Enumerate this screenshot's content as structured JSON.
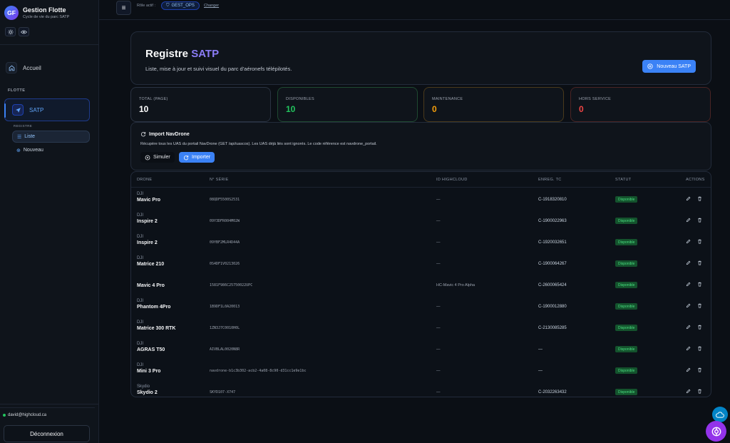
{
  "app": {
    "logo_initials": "GF",
    "title": "Gestion Flotte",
    "subtitle": "Cycle de vie du parc SATP"
  },
  "sidebar": {
    "home_label": "Accueil",
    "section_label": "FLOTTE",
    "satp_label": "SATP",
    "sub_section_label": "REGISTRE",
    "sub_items": [
      {
        "label": "Liste",
        "icon": "list-icon"
      },
      {
        "label": "Nouveau",
        "icon": "plus-circle-icon"
      }
    ],
    "user_email": "david@highcloud.ca",
    "logout_label": "Déconnexion"
  },
  "topbar": {
    "role_label": "Rôle actif :",
    "role_value": "GEST_OPS",
    "change_label": "Changer"
  },
  "header": {
    "title_main": "Registre",
    "title_accent": "SATP",
    "subtitle": "Liste, mise à jour et suivi visuel du parc d'aéronefs télépilotés.",
    "new_button": "Nouveau SATP"
  },
  "stats": [
    {
      "label": "TOTAL (PAGE)",
      "value": "10",
      "color": "#ffffff",
      "border": "#2a3342"
    },
    {
      "label": "DISPONIBLES",
      "value": "10",
      "color": "#22c55e",
      "border": "#1f4a31"
    },
    {
      "label": "MAINTENANCE",
      "value": "0",
      "color": "#f59e0b",
      "border": "#4a3a1c"
    },
    {
      "label": "HORS SERVICE",
      "value": "0",
      "color": "#ef4444",
      "border": "#4a2424"
    }
  ],
  "import": {
    "title": "Import NavDrone",
    "description": "Récupère tous les UAS du portail NavDrone (GET /api/uascos). Les UAS déjà liés sont ignorés. Le code référence est navdrone_portail.",
    "simulate_label": "Simuler",
    "import_label": "Importer"
  },
  "table": {
    "headers": {
      "drone": "DRONE",
      "serial": "N° SÉRIE",
      "hc": "ID HIGHCLOUD",
      "tc": "ENREG. TC",
      "status": "STATUT",
      "actions": "ACTIONS"
    },
    "rows": [
      {
        "brand": "DJI",
        "model": "Mavic Pro",
        "serial": "08QDF5500S2531",
        "hc": "—",
        "tc": "C-1918320810",
        "status": "Disponible"
      },
      {
        "brand": "DJI",
        "model": "Inspire 2",
        "serial": "09Y3DFR004M02W",
        "hc": "—",
        "tc": "C-1900022963",
        "status": "Disponible"
      },
      {
        "brand": "DJI",
        "model": "Inspire 2",
        "serial": "09YBF2MLR4D44A",
        "hc": "—",
        "tc": "C-1920032651",
        "status": "Disponible"
      },
      {
        "brand": "DJI",
        "model": "Matrice 210",
        "serial": "0S4DF1V0213026",
        "hc": "—",
        "tc": "C-1900064267",
        "status": "Disponible"
      },
      {
        "brand": "",
        "model": "Mavic 4 Pro",
        "serial": "1581F986C25750022UPC",
        "hc": "HC-Mavic 4 Pro Alpha",
        "tc": "C-2600065424",
        "status": "Disponible"
      },
      {
        "brand": "DJI",
        "model": "Phantom 4Pro",
        "serial": "1B9DF1L0A20013",
        "hc": "—",
        "tc": "C-1900012880",
        "status": "Disponible"
      },
      {
        "brand": "DJI",
        "model": "Matrice 300 RTK",
        "serial": "1ZN3J7C0010H0L",
        "hc": "—",
        "tc": "C-2130085285",
        "status": "Disponible"
      },
      {
        "brand": "DJI",
        "model": "AGRAS T50",
        "serial": "AIVBLAL0020N8R",
        "hc": "—",
        "tc": "—",
        "status": "Disponible"
      },
      {
        "brand": "DJI",
        "model": "Mini 3 Pro",
        "serial": "navdrone-b1c3b302-acb2-4a08-8c90-d31cc1e9e1bc",
        "hc": "—",
        "tc": "—",
        "status": "Disponible"
      },
      {
        "brand": "Skydio",
        "model": "Skydio 2",
        "serial": "SKYD107-X747",
        "hc": "—",
        "tc": "C-2032263432",
        "status": "Disponible"
      }
    ]
  }
}
